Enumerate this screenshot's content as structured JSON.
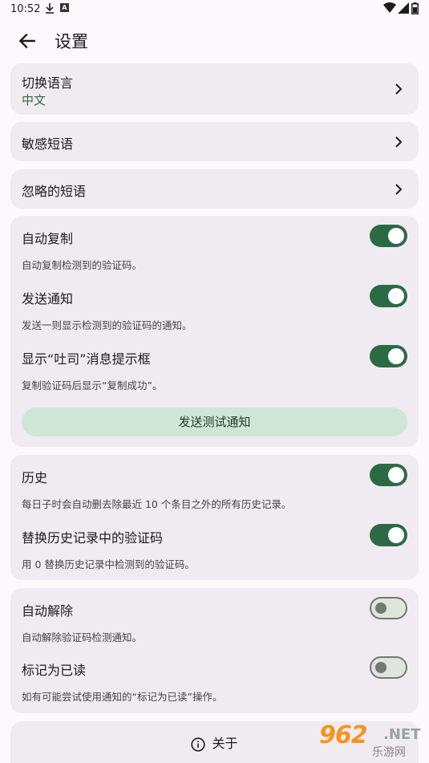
{
  "status_bar": {
    "time": "10:52"
  },
  "app_bar": {
    "title": "设置"
  },
  "language": {
    "label": "切换语言",
    "value": "中文"
  },
  "sensitive_phrases": {
    "label": "敏感短语"
  },
  "ignored_phrases": {
    "label": "忽略的短语"
  },
  "copy_group": {
    "auto_copy": {
      "title": "自动复制",
      "desc": "自动复制检测到的验证码。",
      "enabled": true
    },
    "send_notification": {
      "title": "发送通知",
      "desc": "发送一则显示检测到的验证码的通知。",
      "enabled": true
    },
    "show_toast": {
      "title": "显示“吐司”消息提示框",
      "desc": "复制验证码后显示“复制成功”。",
      "enabled": true
    },
    "test_button": "发送测试通知"
  },
  "history_group": {
    "history": {
      "title": "历史",
      "desc": "每日子时会自动删去除最近 10 个条目之外的所有历史记录。",
      "enabled": true
    },
    "replace_code": {
      "title": "替换历史记录中的验证码",
      "desc": "用 0 替换历史记录中检测到的验证码。",
      "enabled": true
    }
  },
  "dismiss_group": {
    "auto_dismiss": {
      "title": "自动解除",
      "desc": "自动解除验证码检测通知。",
      "enabled": false
    },
    "mark_read": {
      "title": "标记为已读",
      "desc": "如有可能尝试使用通知的“标记为已读”操作。",
      "enabled": false
    }
  },
  "about": {
    "label": "关于"
  },
  "watermark": {
    "number": "962",
    "suffix": ".NET",
    "text": "乐游网"
  },
  "colors": {
    "accent": "#2c6a45",
    "language_value": "#2f6b3d",
    "card": "#f0ebf0",
    "button": "#cfe6d6"
  }
}
